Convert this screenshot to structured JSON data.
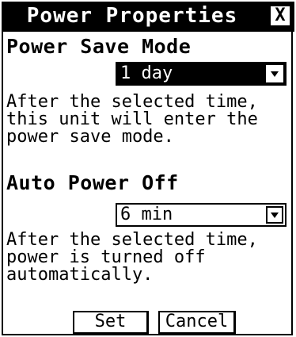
{
  "window": {
    "title": "Power Properties",
    "close_icon": "close-icon",
    "close_glyph": "X"
  },
  "power_save": {
    "heading": "Power Save Mode",
    "selected": "1 day",
    "description": "After the selected time,\nthis unit will enter the\npower save mode."
  },
  "auto_power_off": {
    "heading": "Auto Power Off",
    "selected": "6 min",
    "description": "After the selected time,\npower is turned off\nautomatically."
  },
  "buttons": {
    "set_label": "Set",
    "cancel_label": "Cancel"
  },
  "icons": {
    "dropdown": "chevron-down-icon"
  }
}
